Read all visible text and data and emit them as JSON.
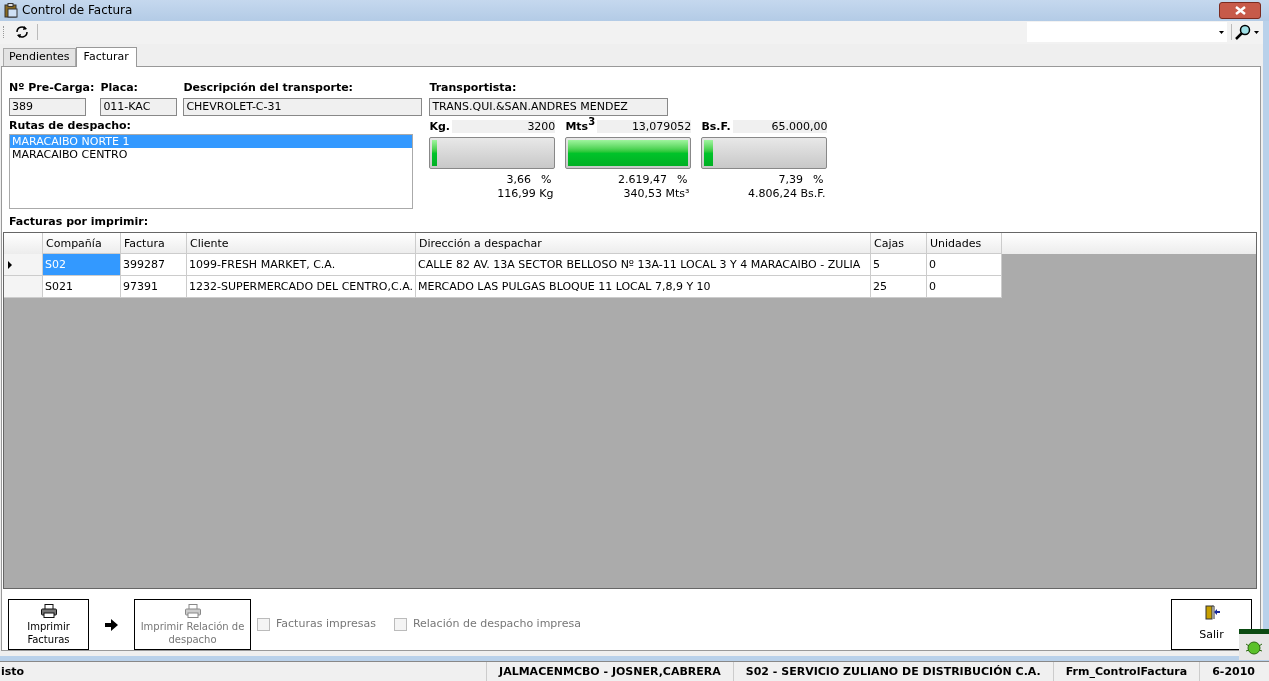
{
  "window": {
    "title": "Control de Factura"
  },
  "tabs": [
    {
      "label": "Pendientes",
      "selected": false
    },
    {
      "label": "Facturar",
      "selected": true
    }
  ],
  "fields": [
    {
      "label": "Nº Pre-Carga:",
      "value": "389"
    },
    {
      "label": "Placa:",
      "value": "011-KAC"
    },
    {
      "label": "Descripción del transporte:",
      "value": "CHEVROLET-C-31"
    },
    {
      "label": "Transportista:",
      "value": "TRANS.QUI.&SAN.ANDRES MENDEZ"
    }
  ],
  "routes": {
    "label": "Rutas de despacho:",
    "items": [
      {
        "label": "MARACAIBO NORTE 1",
        "selected": true
      },
      {
        "label": "MARACAIBO CENTRO",
        "selected": false
      }
    ]
  },
  "meters": [
    {
      "label": "Kg.",
      "capacity": "3200",
      "level": 0.04,
      "percent": "3,66",
      "percent_sign": "%",
      "amount": "116,99 Kg"
    },
    {
      "label": "Mts",
      "sup": "3",
      "capacity": "13,079052",
      "level": 1,
      "percent": "2.619,47",
      "percent_sign": "%",
      "amount": "340,53 Mts³"
    },
    {
      "label": "Bs.F.",
      "capacity": "65.000,00",
      "level": 0.07,
      "percent": "7,39",
      "percent_sign": "%",
      "amount": "4.806,24 Bs.F."
    }
  ],
  "table": {
    "title": "Facturas por imprimir:",
    "columns": [
      "Compañía",
      "Factura",
      "Cliente",
      "Dirección a despachar",
      "Cajas",
      "Unidades"
    ],
    "rows": [
      {
        "selected": true,
        "cells": [
          "S02",
          "399287",
          "1099-FRESH MARKET, C.A.",
          "CALLE 82 AV. 13A SECTOR BELLOSO Nº 13A-11 LOCAL 3 Y 4 MARACAIBO - ZULIA",
          "5",
          "0"
        ]
      },
      {
        "selected": false,
        "cells": [
          "S021",
          "97391",
          "1232-SUPERMERCADO DEL CENTRO,C.A.",
          "MERCADO LAS PULGAS BLOQUE 11 LOCAL 7,8,9 Y 10",
          "25",
          "0"
        ]
      }
    ]
  },
  "actions": [
    {
      "label": "Imprimir Facturas",
      "disabled": false
    },
    {
      "label": "Imprimir Relación de despacho",
      "disabled": true
    }
  ],
  "checks": [
    {
      "label": "Facturas impresas",
      "checked": false,
      "disabled": true
    },
    {
      "label": "Relación de despacho impresa",
      "checked": false,
      "disabled": true
    }
  ],
  "exit_button": {
    "label": "Salir"
  },
  "status_bar": [
    "isto",
    "JALMACENMCBO - JOSNER,CABRERA",
    "S02 - SERVICIO ZULIANO DE DISTRIBUCIÓN C.A.",
    "Frm_ControlFactura",
    "6-2010"
  ]
}
